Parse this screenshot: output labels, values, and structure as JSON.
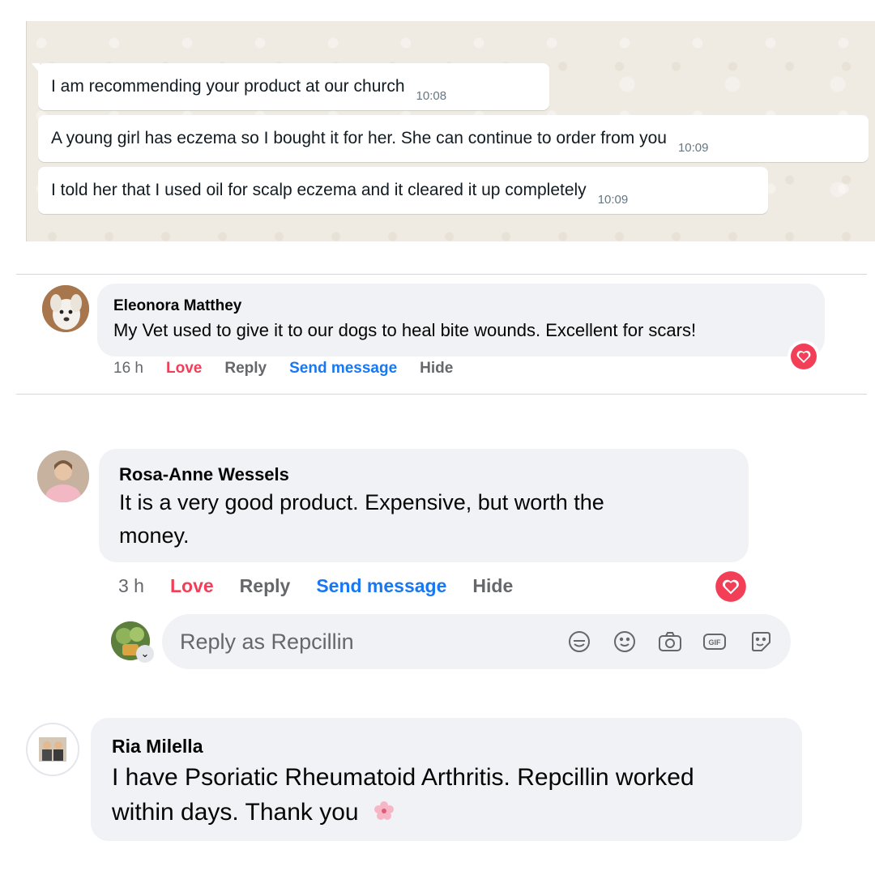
{
  "whatsapp": {
    "messages": [
      {
        "text": "I am recommending your product at our church",
        "time": "10:08"
      },
      {
        "text": "A young girl has eczema so I bought it for her. She can continue to order from you",
        "time": "10:09"
      },
      {
        "text": "I told her that I used oil for scalp eczema and it cleared it up completely",
        "time": "10:09"
      }
    ]
  },
  "comments": [
    {
      "name": "Eleonora Matthey",
      "text_lines": [
        "My Vet used to give it to our dogs to heal bite wounds. Excellent for scars!"
      ],
      "time": "16 h",
      "actions": {
        "love": "Love",
        "reply": "Reply",
        "send_message": "Send message",
        "hide": "Hide"
      },
      "reaction_icon": "heart-icon"
    },
    {
      "name": "Rosa-Anne Wessels",
      "text_lines": [
        "It is a very good product. Expensive, but worth the",
        "money."
      ],
      "time": "3 h",
      "actions": {
        "love": "Love",
        "reply": "Reply",
        "send_message": "Send message",
        "hide": "Hide"
      },
      "reaction_icon": "heart-icon"
    },
    {
      "name": "Ria Milella",
      "text_lines": [
        "I have Psoriatic Rheumatoid Arthritis. Repcillin worked",
        "within days. Thank you"
      ],
      "emoji": "cherry-blossom-icon"
    }
  ],
  "composer": {
    "placeholder": "Reply as Repcillin",
    "icons": [
      "avatar-sticker-icon",
      "emoji-icon",
      "camera-icon",
      "gif-icon",
      "sticker-icon"
    ],
    "gif_label": "GIF"
  },
  "colors": {
    "love": "#f33e58",
    "send_message": "#1877f2",
    "muted": "#65676b",
    "bubble": "#f0f2f5",
    "whatsapp_bg": "#efeae2"
  }
}
